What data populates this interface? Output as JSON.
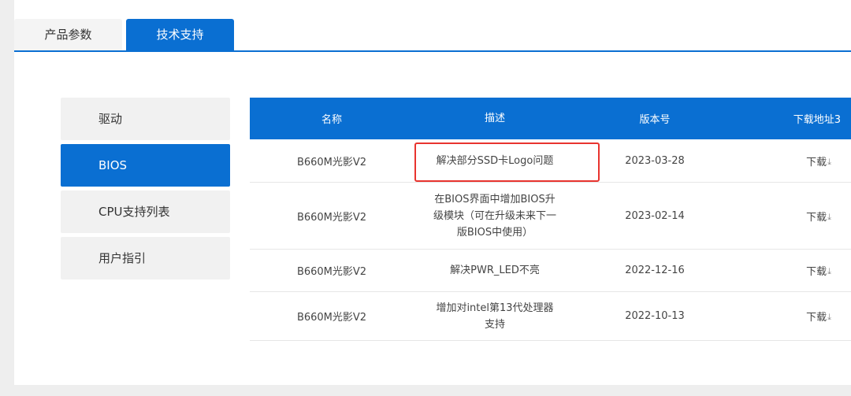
{
  "tabs": {
    "params": "产品参数",
    "support": "技术支持"
  },
  "sidebar": {
    "items": [
      {
        "label": "驱动"
      },
      {
        "label": "BIOS"
      },
      {
        "label": "CPU支持列表"
      },
      {
        "label": "用户指引"
      }
    ]
  },
  "table": {
    "headers": {
      "name": "名称",
      "desc": "描述",
      "version": "版本号",
      "download": "下载地址3"
    },
    "rows": [
      {
        "name": "B660M光影V2",
        "desc": "解决部分SSD卡Logo问题",
        "version": "2023-03-28",
        "download": "下载"
      },
      {
        "name": "B660M光影V2",
        "desc": "在BIOS界面中增加BIOS升级模块（可在升级未来下一版BIOS中使用）",
        "version": "2023-02-14",
        "download": "下载"
      },
      {
        "name": "B660M光影V2",
        "desc": "解决PWR_LED不亮",
        "version": "2022-12-16",
        "download": "下载"
      },
      {
        "name": "B660M光影V2",
        "desc": "增加对intel第13代处理器支持",
        "version": "2022-10-13",
        "download": "下载"
      }
    ]
  },
  "icons": {
    "download": "download-arrow-icon"
  },
  "colors": {
    "accent": "#0a6fd2",
    "highlight": "#e8342f"
  }
}
